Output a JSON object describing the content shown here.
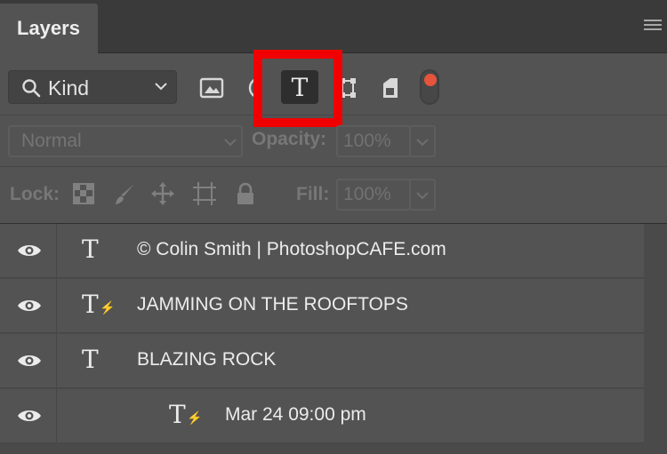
{
  "panel": {
    "tab_label": "Layers",
    "menu_icon": "hamburger-menu-icon"
  },
  "filter": {
    "kind_label": "Kind",
    "kind_icon": "search-icon",
    "type_filter_glyph": "T",
    "icons": [
      "pixel-filter-icon",
      "adjustment-filter-icon",
      "type-filter-icon",
      "shape-filter-icon",
      "smart-object-filter-icon"
    ],
    "toggle_color": "#e5543b",
    "highlight_color": "#f00000"
  },
  "blend": {
    "mode_value": "Normal",
    "opacity_label": "Opacity:",
    "opacity_value": "100%"
  },
  "lock": {
    "lock_label": "Lock:",
    "fill_label": "Fill:",
    "fill_value": "100%",
    "icons": [
      "lock-transparent-pixels-icon",
      "lock-image-pixels-icon",
      "lock-position-icon",
      "lock-artboard-icon",
      "lock-all-icon"
    ]
  },
  "layers": [
    {
      "type_glyph": "T",
      "warning": false,
      "name": "© Colin Smith | PhotoshopCAFE.com",
      "indent": false
    },
    {
      "type_glyph": "T",
      "warning": true,
      "name": "JAMMING ON THE  ROOFTOPS",
      "indent": false
    },
    {
      "type_glyph": "T",
      "warning": false,
      "name": "BLAZING ROCK",
      "indent": false
    },
    {
      "type_glyph": "T",
      "warning": true,
      "name": "Mar 24 09:00 pm",
      "indent": true
    }
  ]
}
